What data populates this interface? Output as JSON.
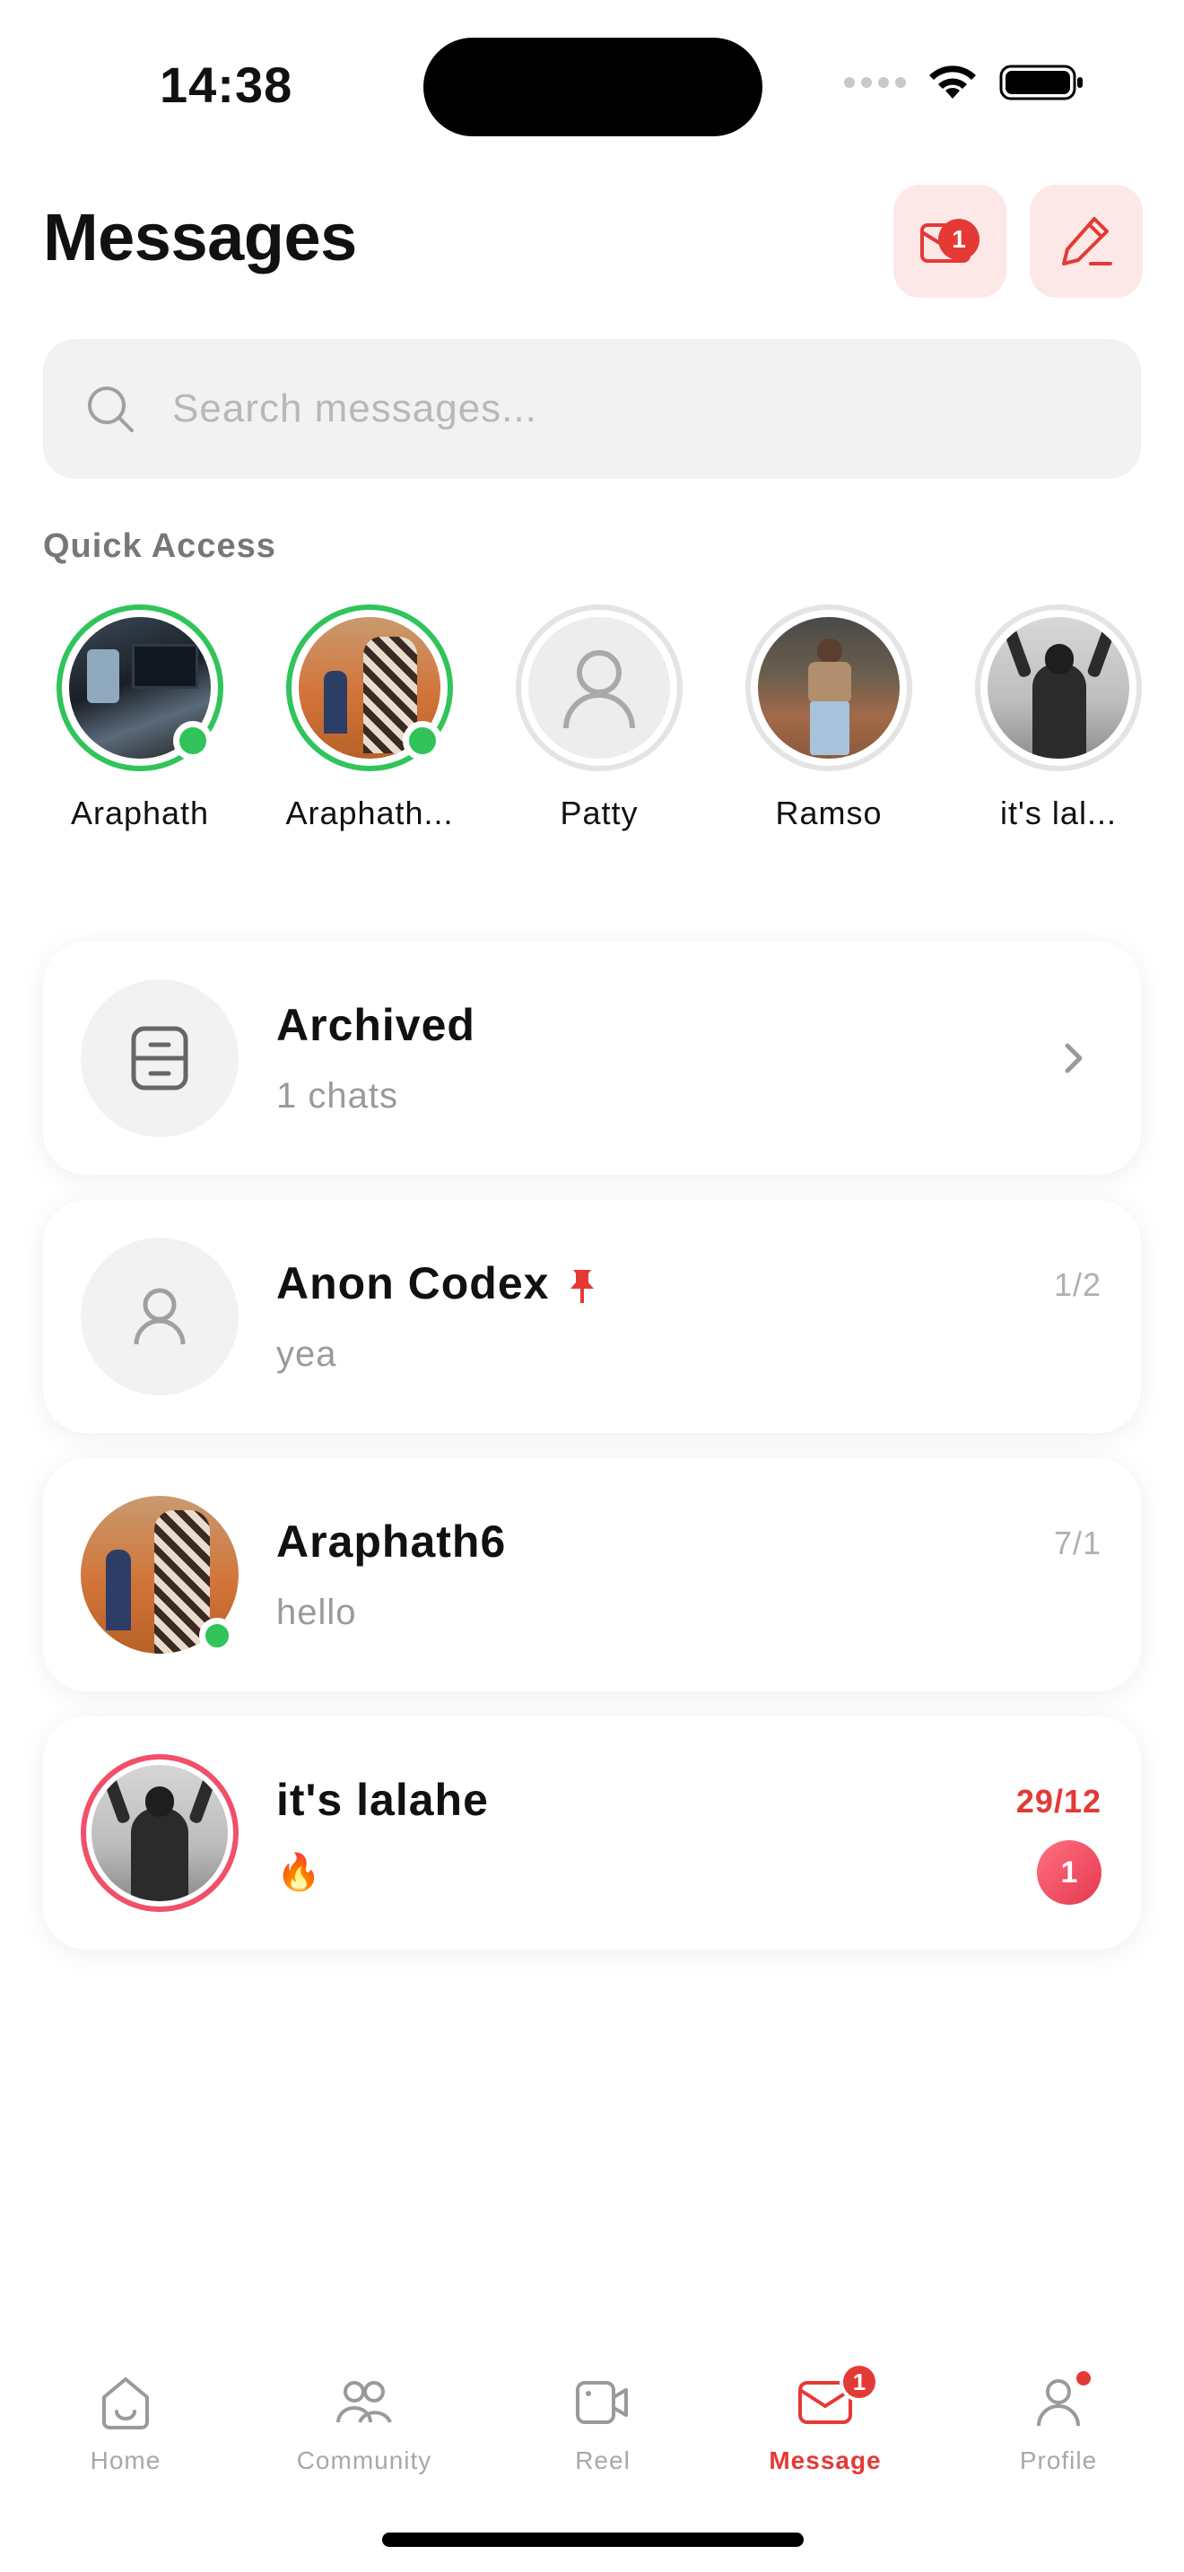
{
  "status_bar": {
    "time": "14:38"
  },
  "header": {
    "title": "Messages",
    "requests_badge": "1"
  },
  "search": {
    "placeholder": "Search messages..."
  },
  "quick_access": {
    "label": "Quick Access",
    "users": [
      {
        "name": "Araphath",
        "online": true
      },
      {
        "name": "Araphath...",
        "online": true
      },
      {
        "name": "Patty",
        "online": false
      },
      {
        "name": "Ramso",
        "online": false
      },
      {
        "name": "it's lal...",
        "online": false
      }
    ]
  },
  "archived": {
    "title": "Archived",
    "subtitle": "1 chats"
  },
  "chats": [
    {
      "name": "Anon Codex",
      "preview": "yea",
      "time": "1/2",
      "pinned": true
    },
    {
      "name": "Araphath6",
      "preview": "hello",
      "time": "7/1",
      "online": true
    },
    {
      "name": "it's lalahe",
      "preview": "🔥",
      "time": "29/12",
      "unread": "1"
    }
  ],
  "tabbar": {
    "items": [
      {
        "label": "Home",
        "icon": "home-icon"
      },
      {
        "label": "Community",
        "icon": "community-icon"
      },
      {
        "label": "Reel",
        "icon": "reel-icon"
      },
      {
        "label": "Message",
        "icon": "message-icon",
        "badge": "1",
        "active": true
      },
      {
        "label": "Profile",
        "icon": "profile-icon"
      }
    ]
  },
  "colors": {
    "accent": "#e53935",
    "online": "#30c45a",
    "button_bg": "#fde8e8"
  }
}
